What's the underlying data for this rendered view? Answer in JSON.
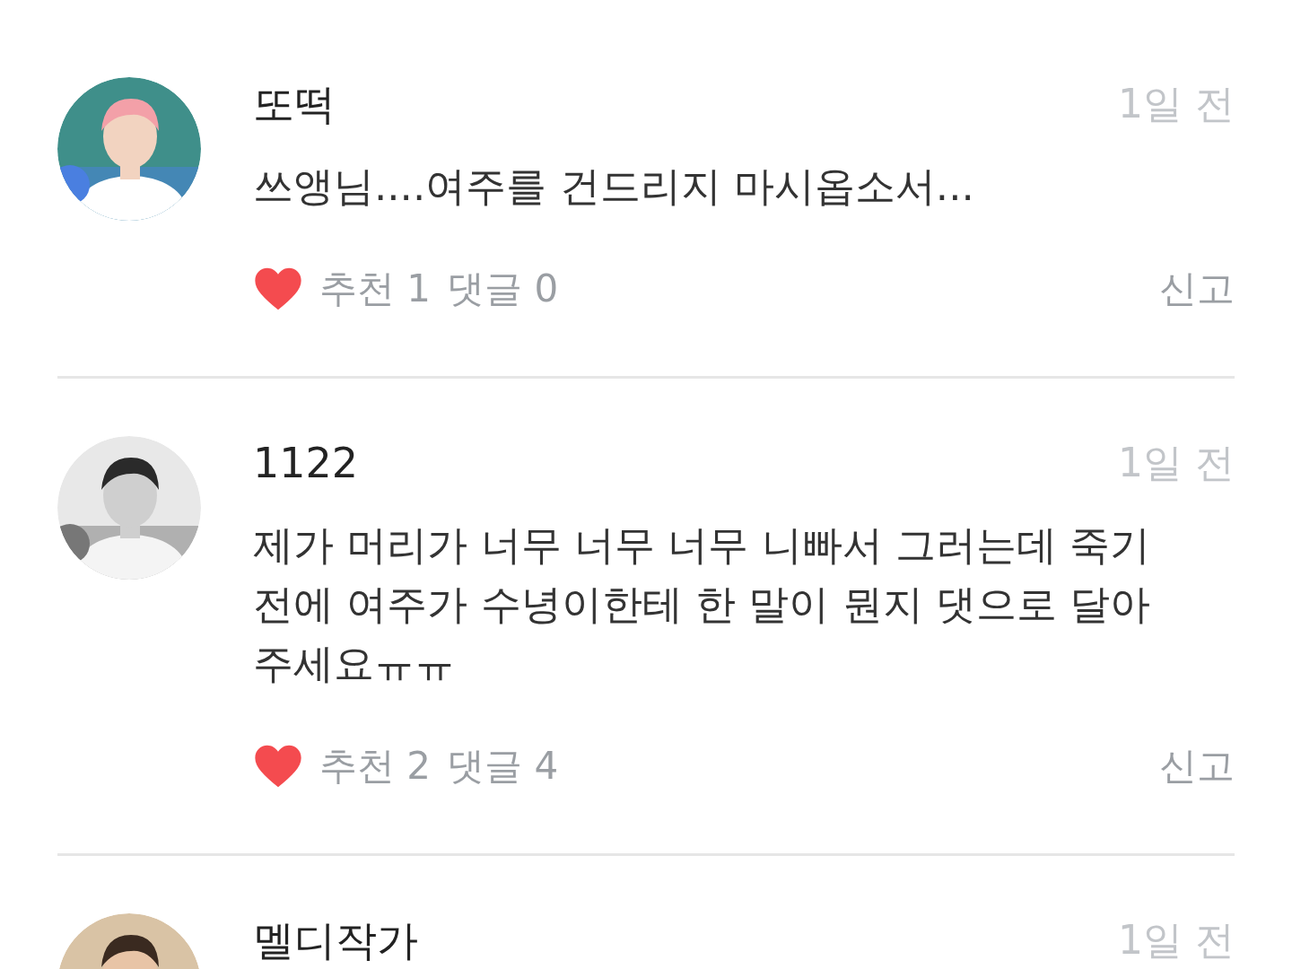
{
  "comments": [
    {
      "author": "또떡",
      "time": "1일 전",
      "body": "쓰앵님....여주를 건드리지 마시옵소서...",
      "likes": "추천 1",
      "replies": "댓글 0",
      "report": "신고"
    },
    {
      "author": "1122",
      "time": "1일 전",
      "body": "제가 머리가 너무 너무 너무 니빠서 그러는데 죽기전에 여주가 수녕이한테 한 말이 뭔지 댓으로 달아주세요ㅠㅠ",
      "likes": "추천 2",
      "replies": "댓글 4",
      "report": "신고"
    },
    {
      "author": "멜디작가",
      "time": "1일 전"
    }
  ]
}
